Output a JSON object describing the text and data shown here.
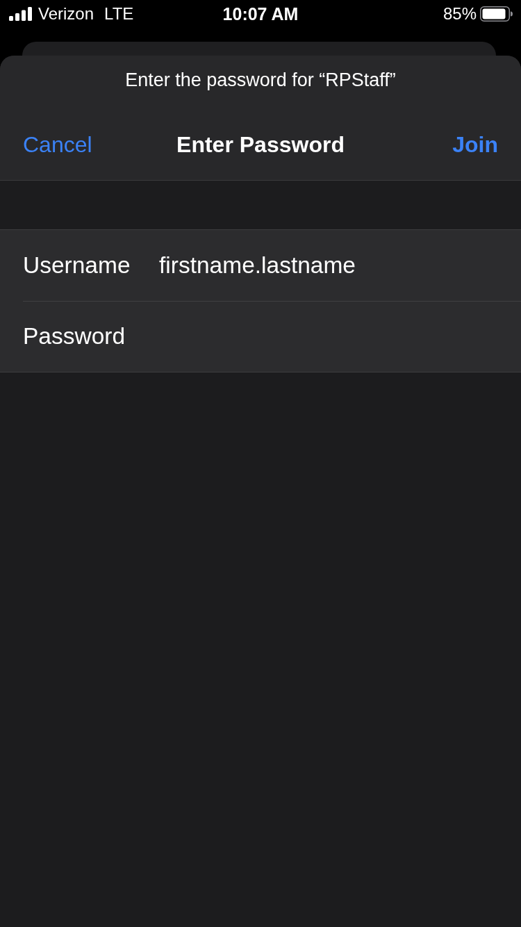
{
  "status_bar": {
    "carrier": "Verizon",
    "network": "LTE",
    "time": "10:07 AM",
    "battery": "85%"
  },
  "sheet": {
    "prompt": "Enter the password for “RPStaff”",
    "nav": {
      "cancel": "Cancel",
      "title": "Enter Password",
      "join": "Join"
    }
  },
  "fields": [
    {
      "label": "Username",
      "value": "firstname.lastname"
    },
    {
      "label": "Password"
    }
  ]
}
